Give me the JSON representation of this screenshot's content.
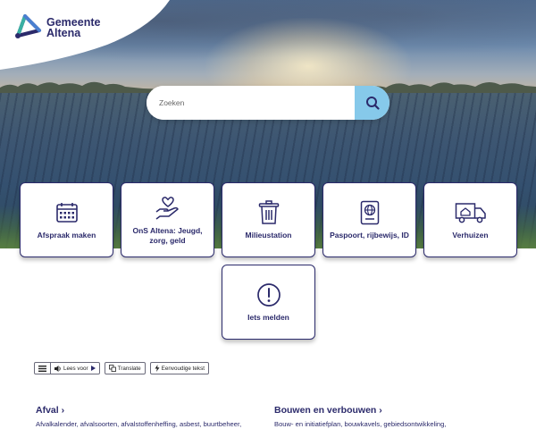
{
  "logo": {
    "line1": "Gemeente",
    "line2": "Altena"
  },
  "search": {
    "placeholder": "Zoeken"
  },
  "tiles": [
    {
      "label": "Afspraak maken",
      "icon": "calendar-icon"
    },
    {
      "label": "OnS Altena: Jeugd, zorg, geld",
      "icon": "hand-heart-icon"
    },
    {
      "label": "Milieustation",
      "icon": "trash-bin-icon"
    },
    {
      "label": "Paspoort, rijbewijs, ID",
      "icon": "passport-icon"
    },
    {
      "label": "Verhuizen",
      "icon": "moving-truck-icon"
    },
    {
      "label": "Iets melden",
      "icon": "alert-circle-icon"
    }
  ],
  "toolbar": {
    "read_label": "Lees voor",
    "translate_label": "Translate",
    "simple_label": "Eenvoudige tekst"
  },
  "sections": [
    {
      "title": "Afval",
      "description": "Afvalkalender, afvalsoorten, afvalstoffenheffing, asbest, buurtbeheer,"
    },
    {
      "title": "Bouwen en verbouwen",
      "description": "Bouw- en initiatiefplan, bouwkavels, gebiedsontwikkeling,"
    }
  ],
  "colors": {
    "brand": "#2b2a6b",
    "search_button": "#86c9ea",
    "logo_accent": "#3ab0a3"
  }
}
